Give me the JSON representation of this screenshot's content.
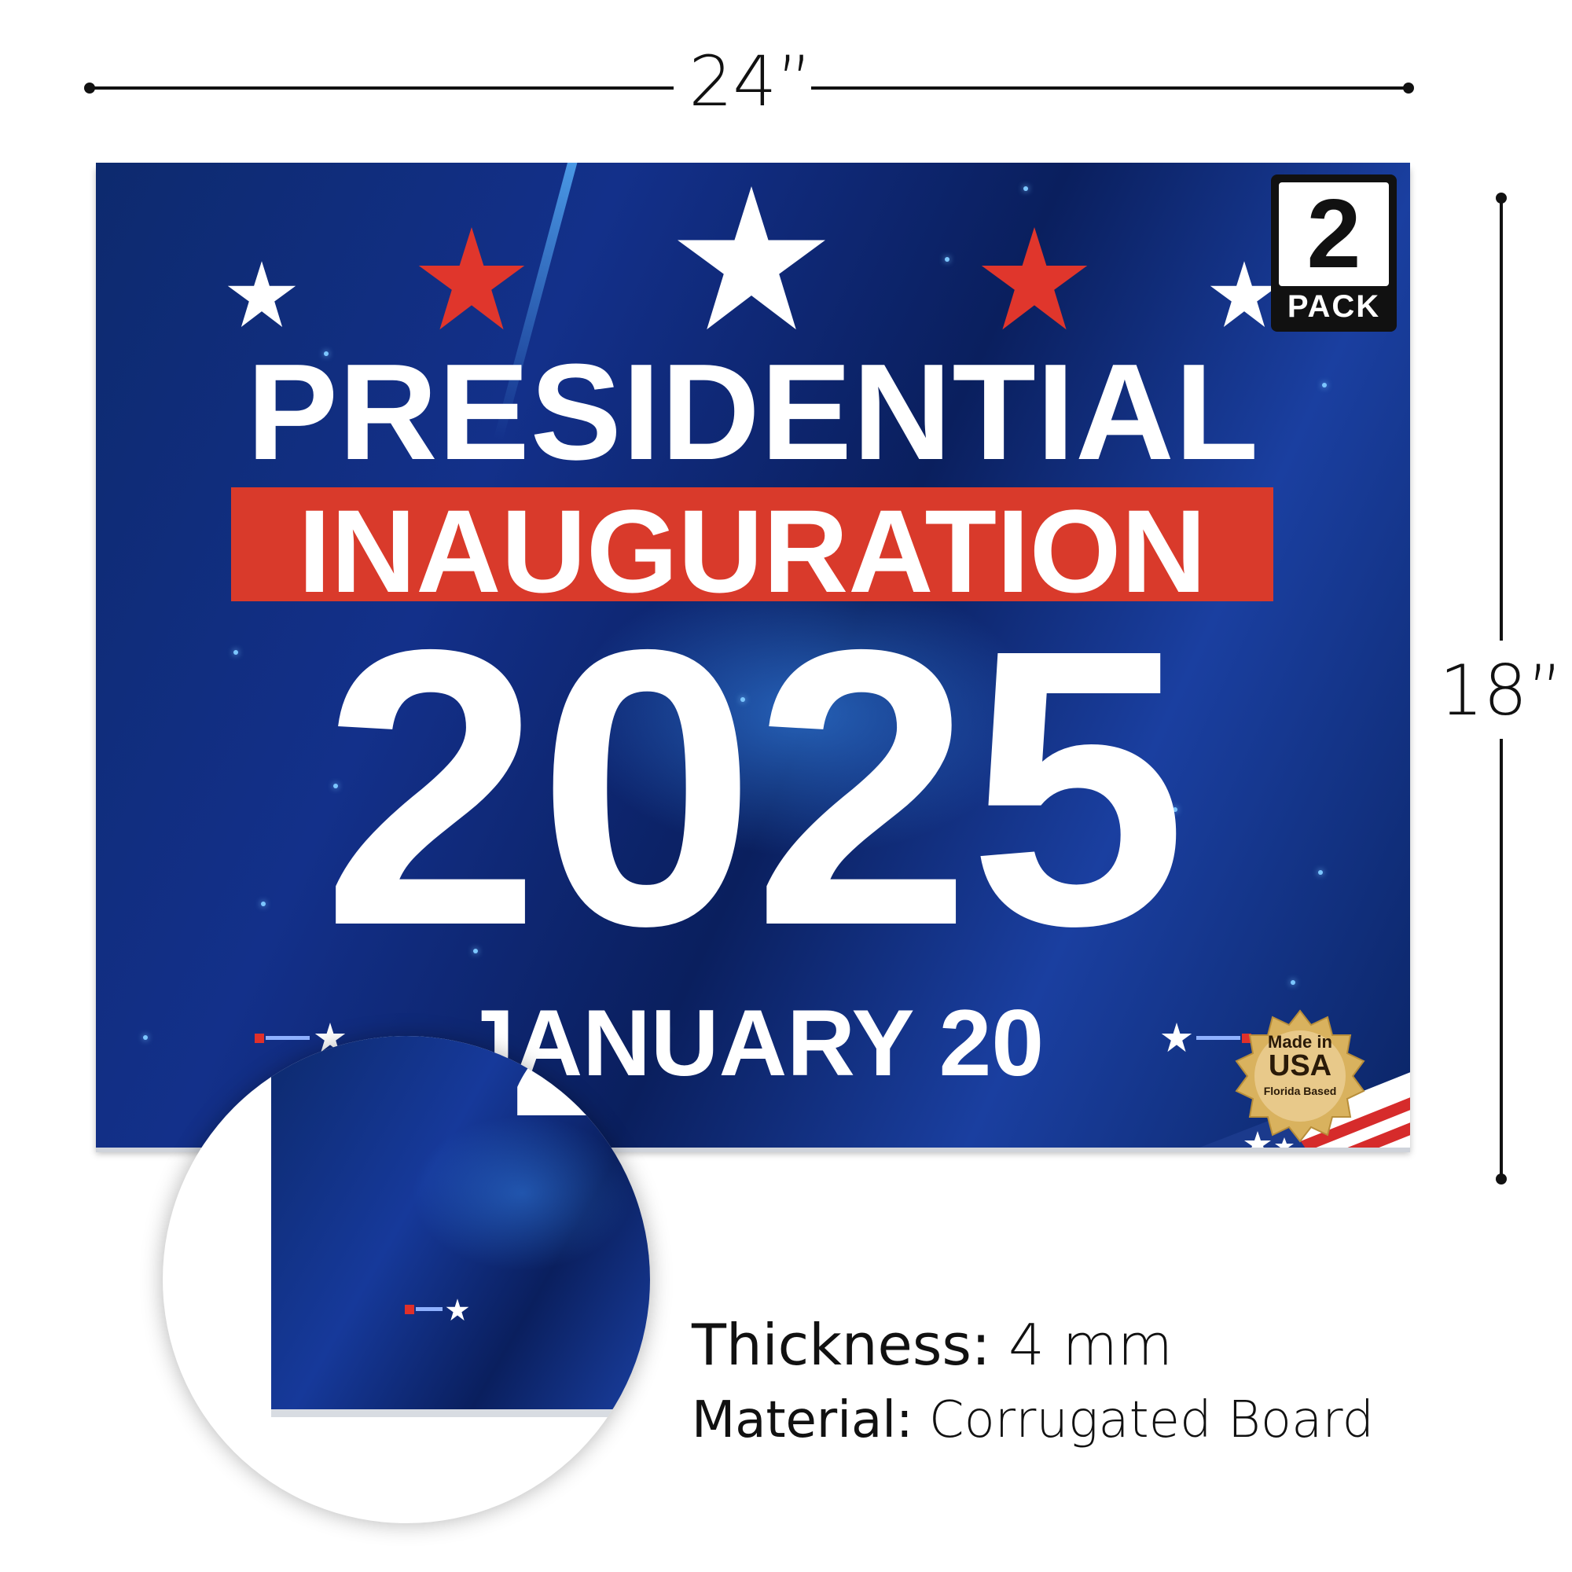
{
  "dimensions": {
    "width_label": "24”",
    "height_label": "18”"
  },
  "sign": {
    "pack_number": "2",
    "pack_label": "PACK",
    "line1": "PRESIDENTIAL",
    "line2": "INAUGURATION",
    "line3": "2025",
    "line4": "JANUARY 20",
    "seal": {
      "line1": "Made in",
      "line2": "USA",
      "line3": "Florida Based"
    },
    "colors": {
      "background": "#13308a",
      "accent_red": "#d93a2b",
      "text": "#ffffff",
      "seal_gold": "#d9b25e"
    }
  },
  "zoom": {
    "digit_partial": "2",
    "text_partial": "JA"
  },
  "specs": [
    {
      "key": "Thickness:",
      "value": "4 mm"
    },
    {
      "key": "Material:",
      "value": "Corrugated Board"
    }
  ]
}
